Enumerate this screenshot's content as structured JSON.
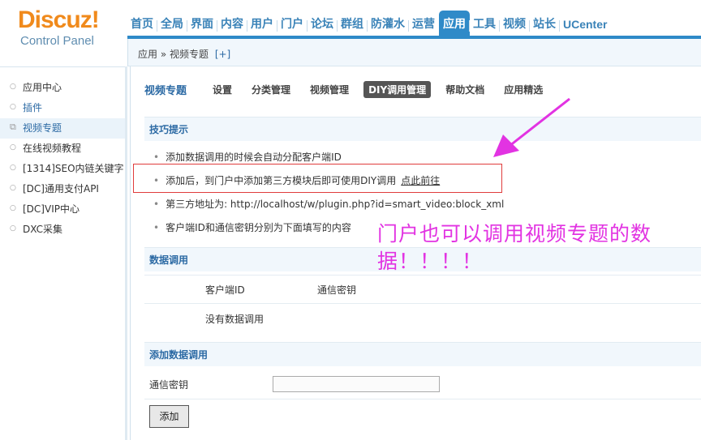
{
  "logo": {
    "brand": "Discuz!",
    "subtitle": "Control Panel"
  },
  "topnav": [
    {
      "label": "首页",
      "active": false
    },
    {
      "label": "全局",
      "active": false
    },
    {
      "label": "界面",
      "active": false
    },
    {
      "label": "内容",
      "active": false
    },
    {
      "label": "用户",
      "active": false
    },
    {
      "label": "门户",
      "active": false
    },
    {
      "label": "论坛",
      "active": false
    },
    {
      "label": "群组",
      "active": false
    },
    {
      "label": "防灌水",
      "active": false
    },
    {
      "label": "运营",
      "active": false
    },
    {
      "label": "应用",
      "active": true
    },
    {
      "label": "工具",
      "active": false
    },
    {
      "label": "视频",
      "active": false
    },
    {
      "label": "站长",
      "active": false
    },
    {
      "label": "UCenter",
      "active": false
    }
  ],
  "breadcrumb": {
    "path": "应用 » 视频专题",
    "add": "[+]"
  },
  "sidebar": {
    "items": [
      {
        "label": "应用中心",
        "icon": "circle-bullet-icon"
      },
      {
        "label": "插件",
        "icon": "circle-bullet-icon"
      },
      {
        "label": "视频专题",
        "icon": "external-link-icon"
      },
      {
        "label": "在线视频教程",
        "icon": "circle-bullet-icon"
      },
      {
        "label": "[1314]SEO内链关键字",
        "icon": "circle-bullet-icon"
      },
      {
        "label": "[DC]通用支付API",
        "icon": "circle-bullet-icon"
      },
      {
        "label": "[DC]VIP中心",
        "icon": "circle-bullet-icon"
      },
      {
        "label": "DXC采集",
        "icon": "circle-bullet-icon"
      }
    ]
  },
  "subtabs": {
    "title": "视频专题",
    "items": [
      {
        "label": "设置",
        "active": false
      },
      {
        "label": "分类管理",
        "active": false
      },
      {
        "label": "视频管理",
        "active": false
      },
      {
        "label": "DIY调用管理",
        "active": true
      },
      {
        "label": "帮助文档",
        "active": false
      },
      {
        "label": "应用精选",
        "active": false
      }
    ]
  },
  "tips": {
    "heading": "技巧提示",
    "items": [
      {
        "text": "添加数据调用的时候会自动分配客户端ID"
      },
      {
        "text": "添加后，到门户中添加第三方模块后即可使用DIY调用",
        "link": "点此前往"
      },
      {
        "text": "第三方地址为: http://localhost/w/plugin.php?id=smart_video:block_xml"
      },
      {
        "text": "客户端ID和通信密钥分别为下面填写的内容"
      }
    ]
  },
  "data_call": {
    "heading": "数据调用",
    "columns": [
      "客户端ID",
      "通信密钥"
    ],
    "empty": "没有数据调用"
  },
  "add_call": {
    "heading": "添加数据调用",
    "key_label": "通信密钥",
    "key_value": "",
    "submit": "添加"
  },
  "annotation": {
    "text": "门户也可以调用视频专题的数据！！！！",
    "color": "#e233e2"
  },
  "colors": {
    "accent": "#2f8ac8",
    "logo": "#f08a1c",
    "highlight_box": "#e03c3c"
  }
}
